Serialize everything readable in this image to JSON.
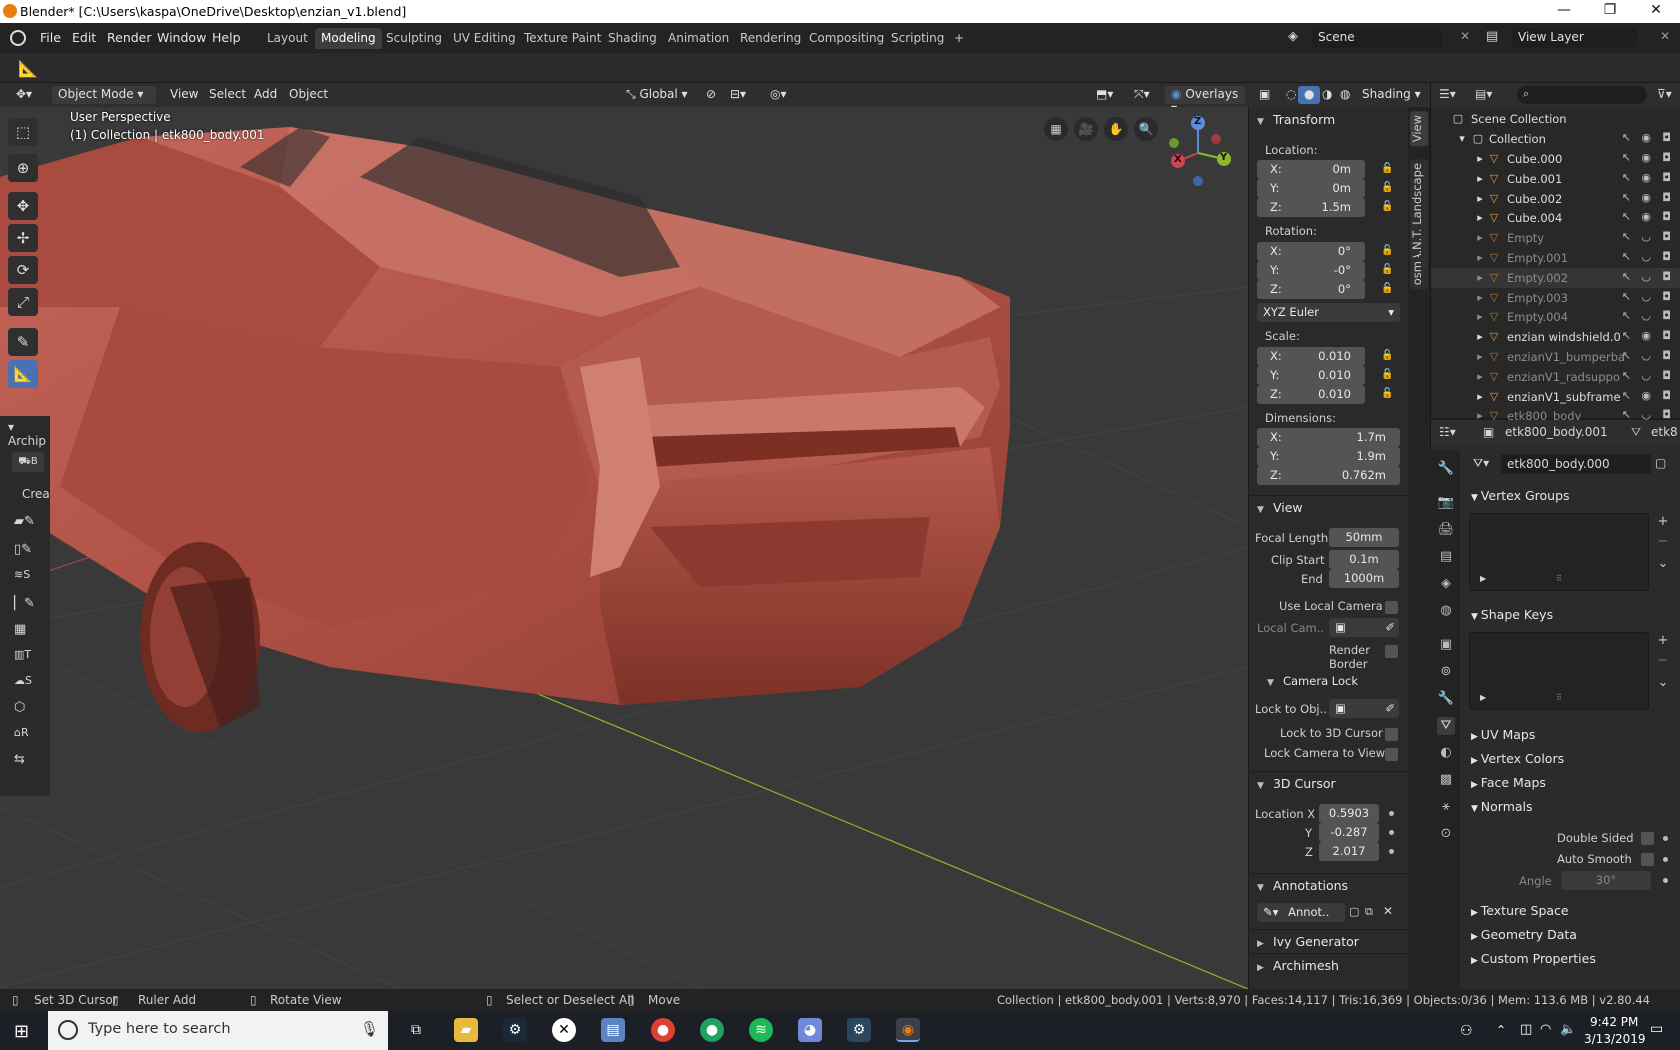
{
  "window": {
    "title": "Blender* [C:\\Users\\kaspa\\OneDrive\\Desktop\\enzian_v1.blend]",
    "minimize": "—",
    "maximize": "❐",
    "close": "✕"
  },
  "menubar": [
    "File",
    "Edit",
    "Render",
    "Window",
    "Help"
  ],
  "workspaces": [
    "Layout",
    "Modeling",
    "Sculpting",
    "UV Editing",
    "Texture Paint",
    "Shading",
    "Animation",
    "Rendering",
    "Compositing",
    "Scripting",
    "+"
  ],
  "active_workspace": "Modeling",
  "scene": "Scene",
  "view_layer": "View Layer",
  "viewport_header": {
    "mode": "Object Mode",
    "menus": [
      "View",
      "Select",
      "Add",
      "Object"
    ],
    "orientation": "Global",
    "overlays": "Overlays",
    "shading": "Shading"
  },
  "viewport": {
    "perspective": "User Perspective",
    "collection_info": "(1) Collection | etk800_body.001",
    "panel_tab": "Archip",
    "panel_create": "Crea",
    "gizmo": {
      "x": "X",
      "y": "Y",
      "z": "Z"
    }
  },
  "tool_labels": [
    "B",
    "S",
    "T",
    "S",
    "R"
  ],
  "transform": {
    "title": "Transform",
    "location_label": "Location:",
    "location": {
      "x": "0m",
      "y": "0m",
      "z": "1.5m"
    },
    "rotation_label": "Rotation:",
    "rotation": {
      "x": "0°",
      "y": "-0°",
      "z": "0°"
    },
    "rotation_mode": "XYZ Euler",
    "scale_label": "Scale:",
    "scale": {
      "x": "0.010",
      "y": "0.010",
      "z": "0.010"
    },
    "dimensions_label": "Dimensions:",
    "dimensions": {
      "x": "1.7m",
      "y": "1.9m",
      "z": "0.762m"
    }
  },
  "axis": {
    "x": "X:",
    "y": "Y:",
    "z": "Z:"
  },
  "view": {
    "title": "View",
    "focal_length_label": "Focal Length",
    "focal_length": "50mm",
    "clip_start_label": "Clip Start",
    "clip_start": "0.1m",
    "end_label": "End",
    "end": "1000m",
    "use_local_camera": "Use Local Camera",
    "local_cam": "Local Cam..",
    "render_border": "Render Border",
    "camera_lock": "Camera Lock",
    "lock_to_obj": "Lock to Obj..",
    "lock_to_cursor": "Lock to 3D Cursor",
    "lock_camera": "Lock Camera to View"
  },
  "cursor": {
    "title": "3D Cursor",
    "loc_x_label": "Location X",
    "y_label": "Y",
    "z_label": "Z",
    "x": "0.5903",
    "y": "-0.287",
    "z": "2.017"
  },
  "annotations": {
    "title": "Annotations",
    "value": "Annot.."
  },
  "addons": [
    "Ivy Generator",
    "Archimesh"
  ],
  "vtabs": [
    "View",
    "A.N.T. Landscape",
    "osm"
  ],
  "outliner": {
    "root": "Scene Collection",
    "collection": "Collection",
    "items": [
      {
        "name": "Cube.000",
        "dim": false
      },
      {
        "name": "Cube.001",
        "dim": false
      },
      {
        "name": "Cube.002",
        "dim": false
      },
      {
        "name": "Cube.004",
        "dim": false
      },
      {
        "name": "Empty",
        "dim": true
      },
      {
        "name": "Empty.001",
        "dim": true
      },
      {
        "name": "Empty.002",
        "dim": true
      },
      {
        "name": "Empty.003",
        "dim": true
      },
      {
        "name": "Empty.004",
        "dim": true
      },
      {
        "name": "enzian windshield.0",
        "dim": false
      },
      {
        "name": "enzianV1_bumperba",
        "dim": true
      },
      {
        "name": "enzianV1_radsuppo",
        "dim": true
      },
      {
        "name": "enzianV1_subframe",
        "dim": false
      },
      {
        "name": "etk800_body",
        "dim": true
      }
    ]
  },
  "properties": {
    "object": "etk800_body.001",
    "object_short": "etk8",
    "mesh": "etk800_body.000",
    "vertex_groups": "Vertex Groups",
    "shape_keys": "Shape Keys",
    "uv_maps": "UV Maps",
    "vertex_colors": "Vertex Colors",
    "face_maps": "Face Maps",
    "normals": "Normals",
    "double_sided": "Double Sided",
    "auto_smooth": "Auto Smooth",
    "angle_label": "Angle",
    "angle": "30°",
    "texture_space": "Texture Space",
    "geometry_data": "Geometry Data",
    "custom_properties": "Custom Properties"
  },
  "statusbar": {
    "set_cursor": "Set 3D Cursor",
    "ruler_add": "Ruler Add",
    "rotate_view": "Rotate View",
    "select_all": "Select or Deselect All",
    "move": "Move",
    "stats": "Collection | etk800_body.001 | Verts:8,970 | Faces:14,117 | Tris:16,369 | Objects:0/36 | Mem: 113.6 MB | v2.80.44"
  },
  "taskbar": {
    "search_placeholder": "Type here to search",
    "time": "9:42 PM",
    "date": "3/13/2019"
  },
  "colors": {
    "accent": "#4772b3",
    "car_body": "#b85a4c",
    "grid_floor": "#393939",
    "axis_x": "#a0444c",
    "axis_y": "#8ab82e"
  }
}
